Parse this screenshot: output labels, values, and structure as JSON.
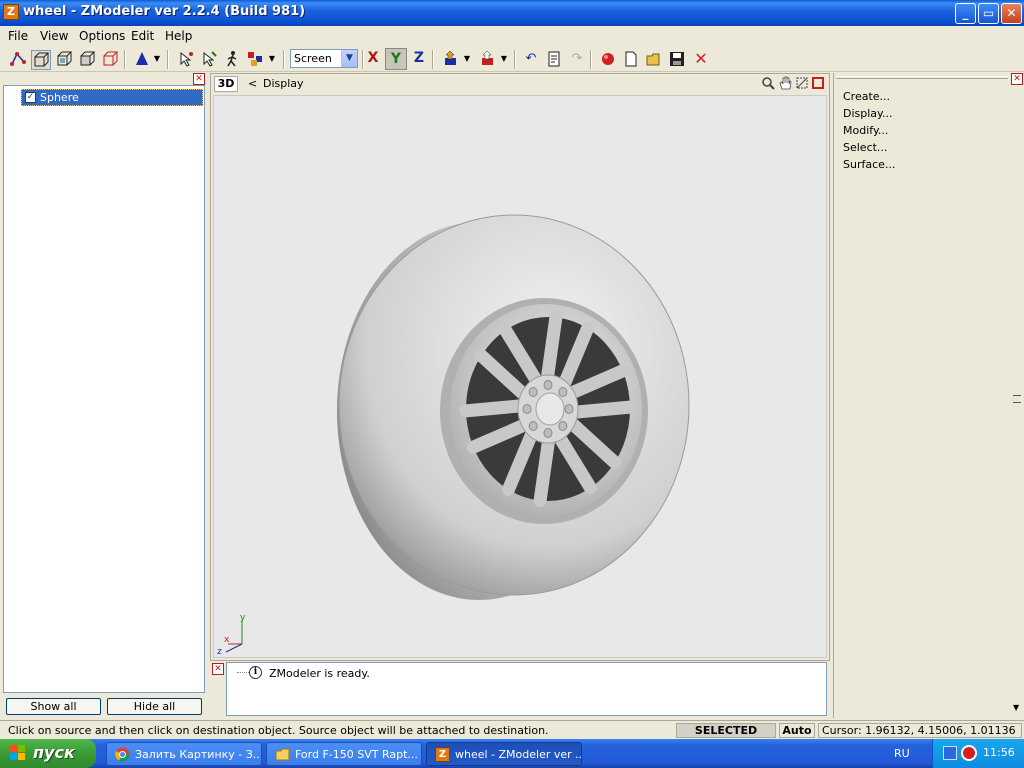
{
  "window": {
    "title": "wheel - ZModeler ver 2.2.4 (Build 981)",
    "icon_letter": "Z",
    "controls": {
      "minimize": "_",
      "maximize": "▭",
      "close": "✕"
    }
  },
  "menu": {
    "file": "File",
    "view": "View",
    "options": "Options",
    "edit": "Edit",
    "help": "Help"
  },
  "toolbar": {
    "coord_system": "Screen",
    "axis_x": "X",
    "axis_y": "Y",
    "axis_z": "Z",
    "colors": {
      "x": "#b01818",
      "y": "#1a7a1a",
      "z": "#1a2ea8"
    }
  },
  "object_list": {
    "items": [
      {
        "label": "Sphere",
        "checked": "✓"
      }
    ],
    "show_all": "Show all",
    "hide_all": "Hide all"
  },
  "viewport": {
    "mode_label": "3D",
    "back_symbol": "<",
    "title": "Display",
    "axis_labels": {
      "y": "y",
      "x": "x",
      "z": "z"
    }
  },
  "log": {
    "message": "ZModeler is ready."
  },
  "command_panel": {
    "items": [
      "Create...",
      "Display...",
      "Modify...",
      "Select...",
      "Surface..."
    ]
  },
  "status": {
    "hint": "Click on source and then click on destination object. Source object will be attached to destination.",
    "mode": "SELECTED MODE",
    "snap": "Auto",
    "cursor": "Cursor: 1.96132, 4.15006, 1.01136"
  },
  "taskbar": {
    "start": "пуск",
    "tasks": [
      {
        "label": "Залить Картинку - З..."
      },
      {
        "label": "Ford F-150 SVT Rapt..."
      },
      {
        "label": "wheel - ZModeler ver ..."
      }
    ],
    "language": "RU",
    "clock": "11:56"
  }
}
